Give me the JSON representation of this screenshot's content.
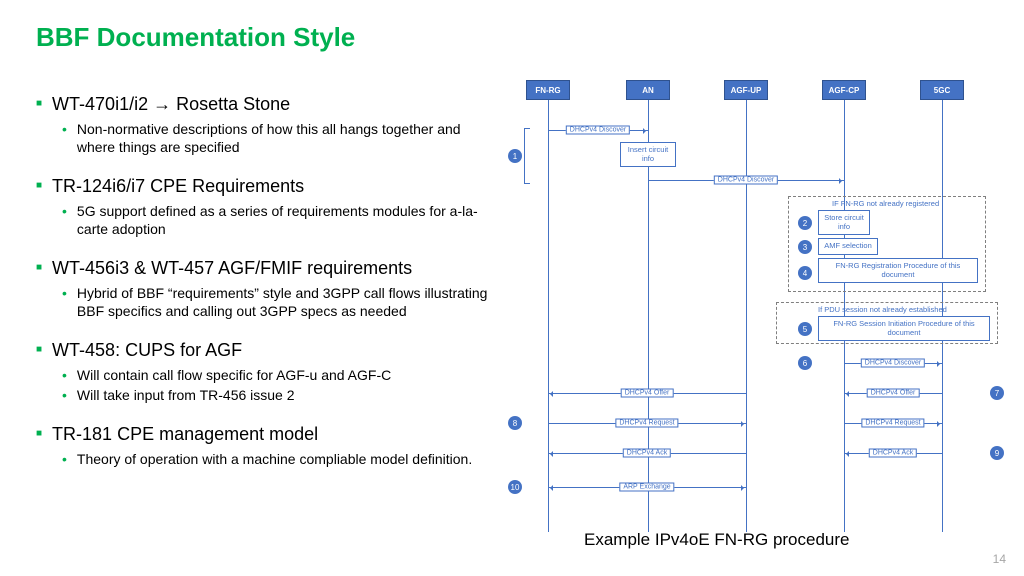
{
  "title": "BBF Documentation Style",
  "pagenum": "14",
  "bullets": [
    {
      "title_pre": "WT-470i1/i2 ",
      "title_post": " Rosetta Stone",
      "subs": [
        "Non-normative descriptions of how this all hangs together and where things are specified"
      ]
    },
    {
      "title_pre": "TR-124i6/i7 CPE Requirements",
      "title_post": "",
      "subs": [
        "5G support defined as a series of requirements modules for a-la-carte adoption"
      ]
    },
    {
      "title_pre": "WT-456i3 & WT-457 AGF/FMIF requirements",
      "title_post": "",
      "subs": [
        "Hybrid of BBF “requirements” style and 3GPP call flows illustrating BBF specifics and calling out 3GPP specs as needed"
      ]
    },
    {
      "title_pre": "WT-458: CUPS for AGF",
      "title_post": "",
      "subs": [
        "Will contain call flow specific for AGF-u and AGF-C",
        "Will take input from TR-456 issue 2"
      ]
    },
    {
      "title_pre": "TR-181 CPE management model",
      "title_post": "",
      "subs": [
        "Theory of operation with a machine compliable model definition."
      ]
    }
  ],
  "caption": "Example IPv4oE FN-RG procedure",
  "diagram": {
    "actors": [
      "FN-RG",
      "AN",
      "AGF-UP",
      "AGF-CP",
      "5GC"
    ],
    "dashboxes": [
      {
        "label": "IF FN-RG not already registered"
      },
      {
        "label": "If PDU session not already established"
      }
    ],
    "boxes": {
      "insert": "Insert circuit info",
      "store": "Store circuit info",
      "amf": "AMF selection",
      "reg": "FN-RG Registration Procedure of this document",
      "sess": "FN-RG Session Initiation Procedure of this document"
    },
    "messages": {
      "dhcp_disc": "DHCPv4 Discover",
      "dhcp_offer": "DHCPv4 Offer",
      "dhcp_req": "DHCPv4 Request",
      "dhcp_ack": "DHCPv4 Ack",
      "arp": "ARP Exchange"
    },
    "steps": [
      "1",
      "2",
      "3",
      "4",
      "5",
      "6",
      "7",
      "8",
      "9",
      "10"
    ]
  }
}
